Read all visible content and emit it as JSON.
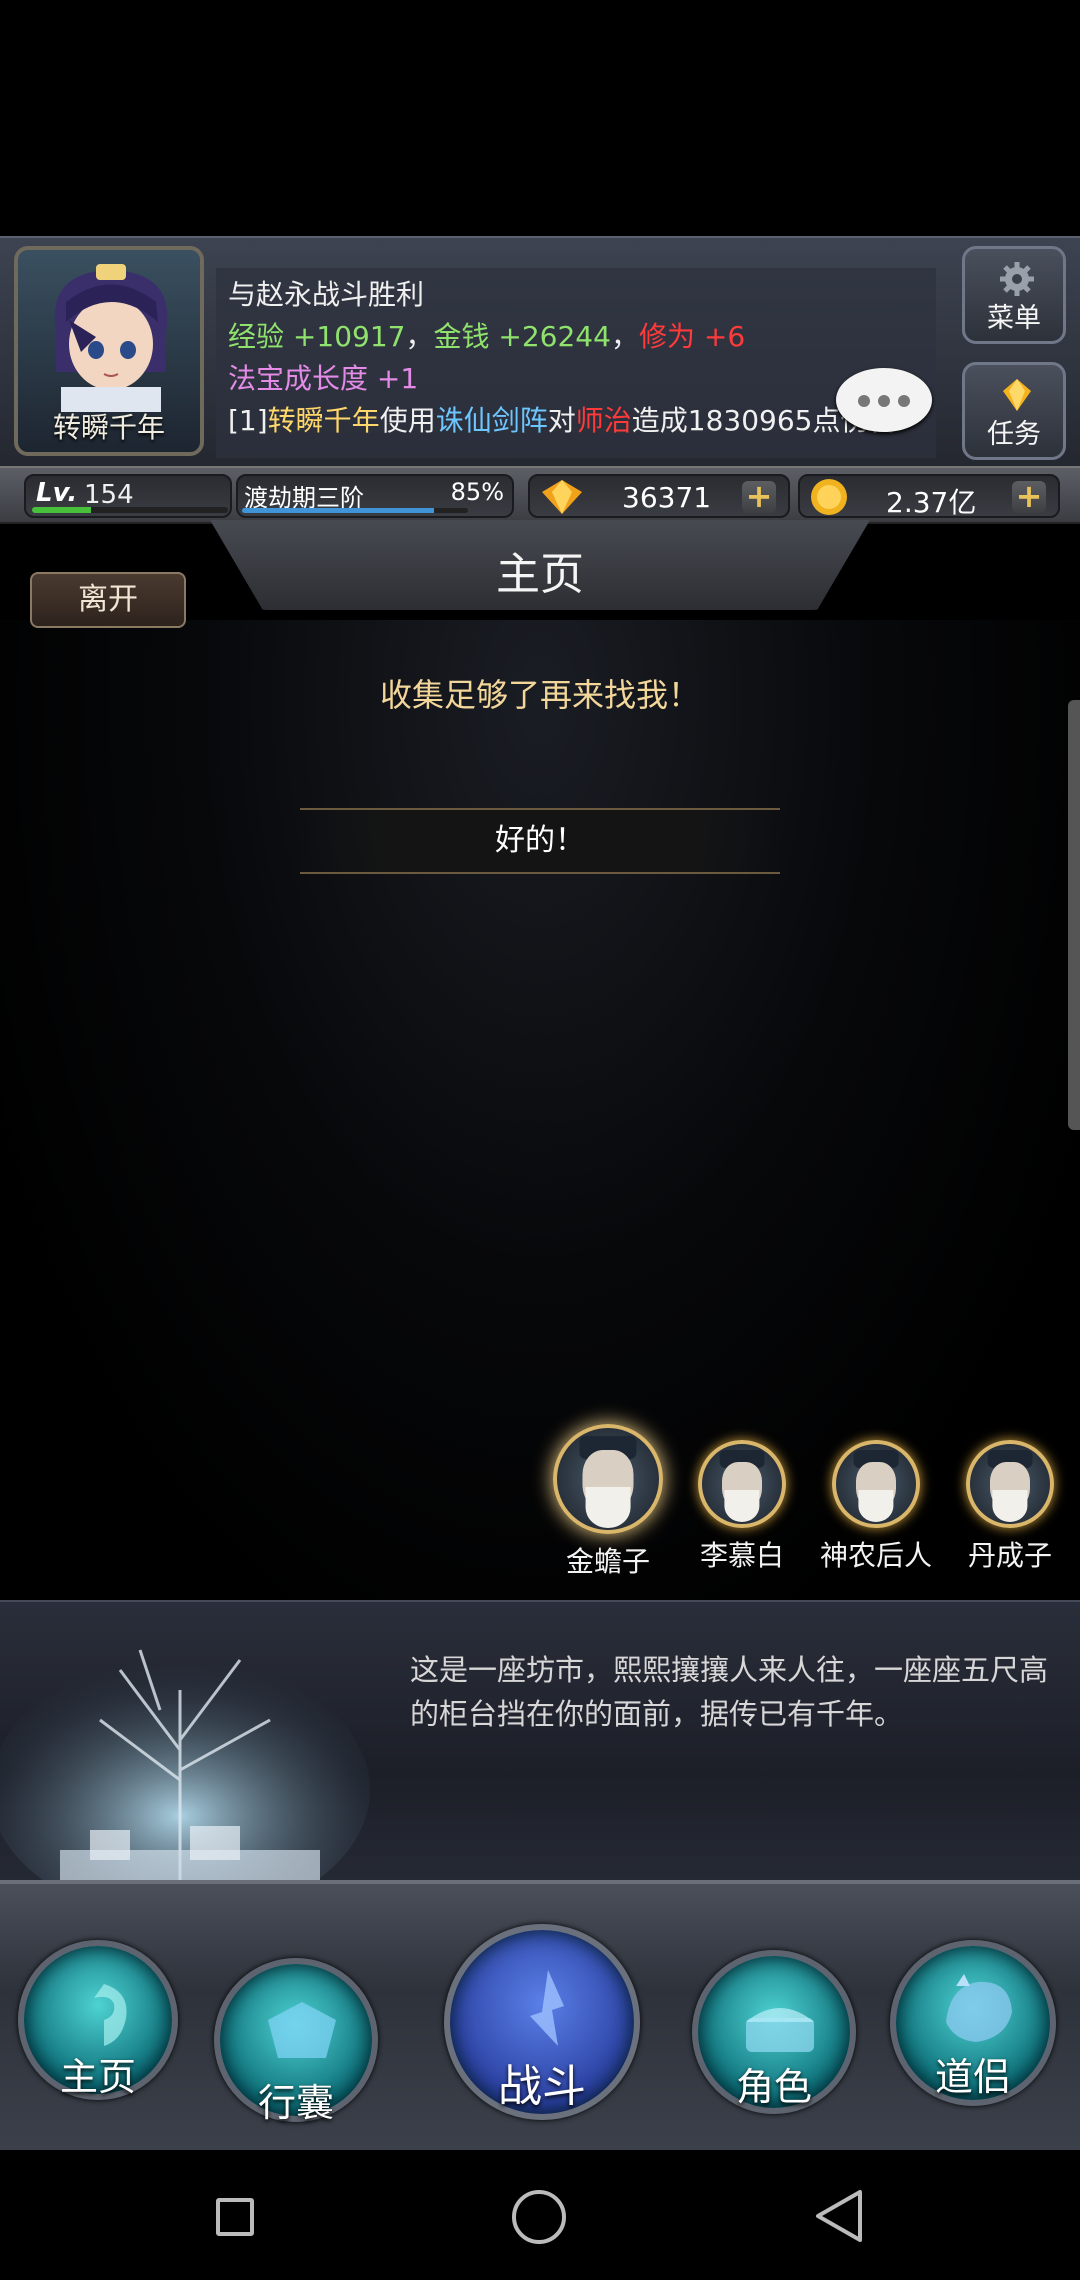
{
  "player": {
    "name": "转瞬千年",
    "level_label": "Lv.",
    "level": "154",
    "level_progress": 0.3,
    "realm": "渡劫期三阶",
    "realm_percent": "85%",
    "realm_progress": 0.85
  },
  "battle_log": {
    "line1": "与赵永战斗胜利",
    "exp_label": "经验",
    "exp_value": "+10917",
    "comma1": "，",
    "money_label": "金钱",
    "money_value": "+26244",
    "comma2": "，",
    "cultivation_label": "修为",
    "cultivation_value": "+6",
    "treasure_label": "法宝成长度",
    "treasure_value": "+1",
    "line4_prefix": "[1]",
    "line4_actor": "转瞬千年",
    "line4_use": "使用",
    "line4_skill": "诛仙剑阵",
    "line4_to": "对",
    "line4_target": "师治",
    "line4_result": "造成1830965点伤害"
  },
  "side_buttons": {
    "menu": "菜单",
    "task": "任务"
  },
  "currency": {
    "gems": "36371",
    "gold": "2.37亿",
    "plus": "+"
  },
  "page": {
    "title": "主页",
    "leave_button": "离开"
  },
  "dialog": {
    "npc_speech": "收集足够了再来找我！",
    "reply": "好的！"
  },
  "npcs": [
    {
      "name": "金蟾子"
    },
    {
      "name": "李慕白"
    },
    {
      "name": "神农后人"
    },
    {
      "name": "丹成子"
    }
  ],
  "location_description": "这是一座坊市，熙熙攘攘人来人往，一座座五尺高的柜台挡在你的面前，据传已有千年。",
  "bottom_nav": {
    "home": "主页",
    "bag": "行囊",
    "battle": "战斗",
    "character": "角色",
    "partner": "道侣"
  },
  "colors": {
    "exp_green": "#8fe36d",
    "cultivation_red": "#ff3a3a",
    "treasure_pink": "#e38be6",
    "npc_speech_gold": "#f2d69a",
    "skill_blue": "#6ec6ff"
  }
}
